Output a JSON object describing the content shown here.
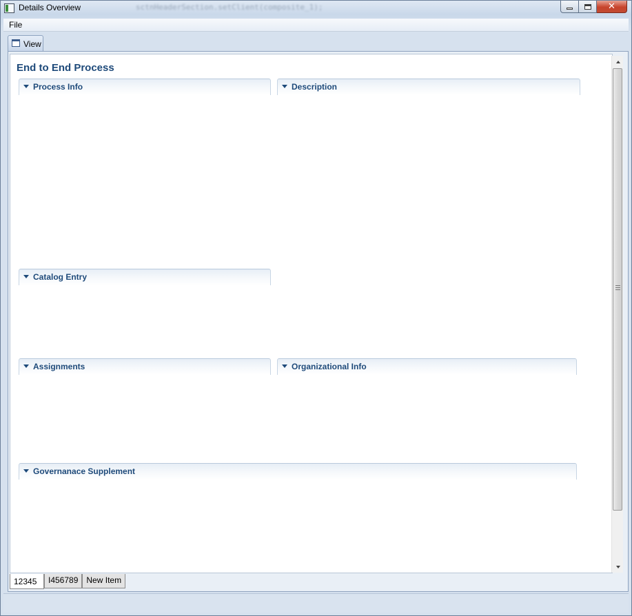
{
  "window": {
    "title": "Details Overview",
    "background_title_text": "sctnHeaderSection.setClient(composite_1);",
    "controls": {
      "minimize": "minimize",
      "maximize": "maximize",
      "close": "✕"
    }
  },
  "menubar": {
    "items": [
      {
        "label": "File"
      }
    ]
  },
  "editor_tab": {
    "label": "View",
    "icon": "window-icon"
  },
  "page": {
    "title": "End to End Process",
    "sections": [
      {
        "id": "process-info",
        "label": "Process Info",
        "expanded": true
      },
      {
        "id": "description",
        "label": "Description",
        "expanded": true
      },
      {
        "id": "catalog-entry",
        "label": "Catalog Entry",
        "expanded": true
      },
      {
        "id": "assignments",
        "label": "Assignments",
        "expanded": true
      },
      {
        "id": "organizational-info",
        "label": "Organizational Info",
        "expanded": true
      },
      {
        "id": "governance-supplement",
        "label": "Governanace Supplement",
        "expanded": true
      }
    ]
  },
  "bottom_tabs": [
    {
      "label": "12345",
      "active": true
    },
    {
      "label": "I456789",
      "active": false
    },
    {
      "label": "New Item",
      "active": false
    }
  ],
  "colors": {
    "section_title": "#1e4a7a",
    "window_frame": "#d6e1ee",
    "close_button": "#c7432b"
  }
}
